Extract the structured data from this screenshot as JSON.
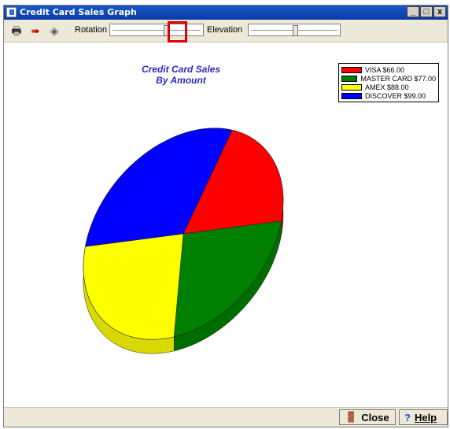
{
  "window": {
    "title": "Credit Card Sales Graph"
  },
  "titlebar_buttons": {
    "minimize": "_",
    "restore": "□",
    "close": "x"
  },
  "toolbar": {
    "print_icon": "printer-icon",
    "export_icon": "export-icon",
    "settings_icon": "gem-icon",
    "rotation_label": "Rotation",
    "rotation_value": 0.62,
    "elevation_label": "Elevation",
    "elevation_value": 0.52
  },
  "chart": {
    "title_line1": "Credit Card Sales",
    "title_line2": "By Amount"
  },
  "chart_data": {
    "type": "pie",
    "title": "Credit Card Sales By Amount",
    "slices": [
      {
        "label": "VISA",
        "value": 66.0,
        "legend_text": "VISA $66.00",
        "color": "#ff0000"
      },
      {
        "label": "MASTER CARD",
        "value": 77.0,
        "legend_text": "MASTER CARD $77.00",
        "color": "#008000"
      },
      {
        "label": "AMEX",
        "value": 88.0,
        "legend_text": "AMEX $88.00",
        "color": "#ffff00"
      },
      {
        "label": "DISCOVER",
        "value": 99.0,
        "legend_text": "DISCOVER $99.00",
        "color": "#0000ff"
      }
    ],
    "legend_position": "top-right",
    "style": "3d"
  },
  "buttons": {
    "close_label": "Close",
    "help_label": "Help"
  }
}
